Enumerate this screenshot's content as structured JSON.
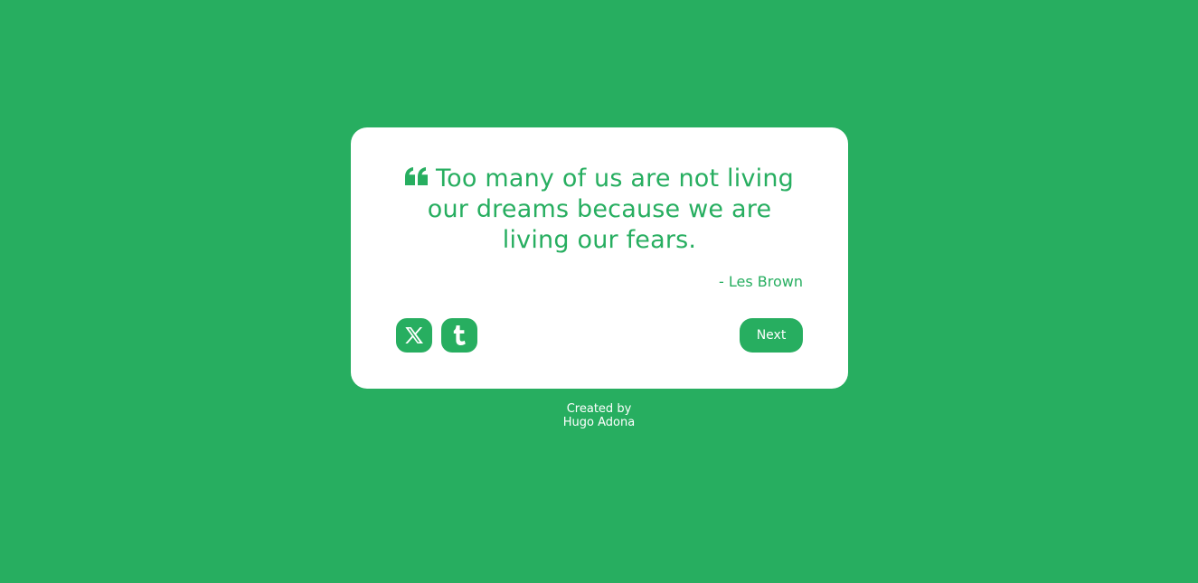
{
  "theme": {
    "background": "#27ae60",
    "card_background": "#ffffff",
    "accent": "#27ae60",
    "button_text": "#ffffff"
  },
  "quote": {
    "icon": "quote-left-icon",
    "text": "Too many of us are not living our dreams because we are living our fears.",
    "author": "- Les Brown"
  },
  "actions": {
    "twitter_icon": "x-twitter-icon",
    "tumblr_icon": "tumblr-icon",
    "next_label": "Next"
  },
  "footer": {
    "created_by": "Created by",
    "author_name": "Hugo Adona"
  }
}
